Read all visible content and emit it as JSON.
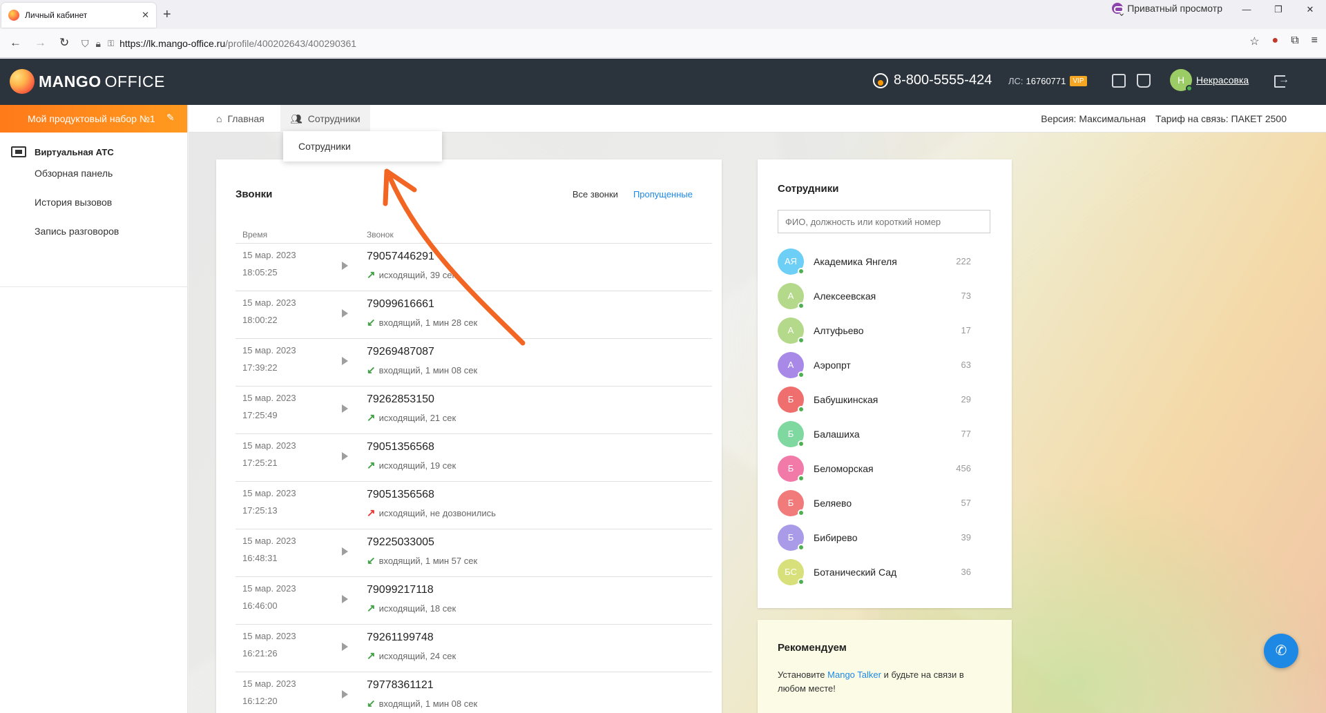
{
  "browser": {
    "tab_title": "Личный кабинет",
    "tab_close": "✕",
    "new_tab": "+",
    "private_label": "Приватный просмотр",
    "url_host": "https://lk.mango-office.ru",
    "url_path": "/profile/400202643/400290361"
  },
  "header": {
    "logo_mango": "MANGO",
    "logo_office": "OFFICE",
    "phone": "8-800-5555-424",
    "account_label": "ЛС:",
    "account_number": "16760771",
    "vip_badge": "VIP",
    "user_initial": "Н",
    "user_name": "Некрасовка"
  },
  "sidebar": {
    "product_set": "Мой продуктовый набор №1",
    "section_title": "Виртуальная АТС",
    "items": [
      {
        "label": "Обзорная панель"
      },
      {
        "label": "История вызовов"
      },
      {
        "label": "Запись разговоров"
      }
    ]
  },
  "subnav": {
    "home": "Главная",
    "employees": "Сотрудники",
    "version": "Версия: Максимальная",
    "tariff": "Тариф на связь: ПАКЕТ 2500",
    "dropdown_item": "Сотрудники"
  },
  "calls": {
    "title": "Звонки",
    "filter_all": "Все звонки",
    "filter_missed": "Пропущенные",
    "col_time": "Время",
    "col_call": "Звонок",
    "rows": [
      {
        "date": "15 мар. 2023",
        "time": "18:05:25",
        "number": "79057446291",
        "desc": "исходящий, 39 сек",
        "dir": "↗",
        "kind": "out",
        "play": true
      },
      {
        "date": "15 мар. 2023",
        "time": "18:00:22",
        "number": "79099616661",
        "desc": "входящий, 1 мин 28 сек",
        "dir": "↙",
        "kind": "in",
        "play": true
      },
      {
        "date": "15 мар. 2023",
        "time": "17:39:22",
        "number": "79269487087",
        "desc": "входящий, 1 мин 08 сек",
        "dir": "↙",
        "kind": "in",
        "play": true
      },
      {
        "date": "15 мар. 2023",
        "time": "17:25:49",
        "number": "79262853150",
        "desc": "исходящий, 21 сек",
        "dir": "↗",
        "kind": "out",
        "play": true
      },
      {
        "date": "15 мар. 2023",
        "time": "17:25:21",
        "number": "79051356568",
        "desc": "исходящий, 19 сек",
        "dir": "↗",
        "kind": "out",
        "play": true
      },
      {
        "date": "15 мар. 2023",
        "time": "17:25:13",
        "number": "79051356568",
        "desc": "исходящий, не дозвонились",
        "dir": "↗",
        "kind": "fail",
        "play": false
      },
      {
        "date": "15 мар. 2023",
        "time": "16:48:31",
        "number": "79225033005",
        "desc": "входящий, 1 мин 57 сек",
        "dir": "↙",
        "kind": "in",
        "play": true
      },
      {
        "date": "15 мар. 2023",
        "time": "16:46:00",
        "number": "79099217118",
        "desc": "исходящий, 18 сек",
        "dir": "↗",
        "kind": "out",
        "play": true
      },
      {
        "date": "15 мар. 2023",
        "time": "16:21:26",
        "number": "79261199748",
        "desc": "исходящий, 24 сек",
        "dir": "↗",
        "kind": "out",
        "play": true
      },
      {
        "date": "15 мар. 2023",
        "time": "16:12:20",
        "number": "79778361121",
        "desc": "входящий, 1 мин 08 сек",
        "dir": "↙",
        "kind": "in",
        "play": true
      }
    ]
  },
  "employees": {
    "title": "Сотрудники",
    "search_placeholder": "ФИО, должность или короткий номер",
    "list": [
      {
        "initials": "АЯ",
        "name": "Академика Янгеля",
        "ext": "222",
        "color": "#6ecff6"
      },
      {
        "initials": "А",
        "name": "Алексеевская",
        "ext": "73",
        "color": "#b5d98a"
      },
      {
        "initials": "А",
        "name": "Алтуфьево",
        "ext": "17",
        "color": "#b5d98a"
      },
      {
        "initials": "А",
        "name": "Аэропрт",
        "ext": "63",
        "color": "#a989e8"
      },
      {
        "initials": "Б",
        "name": "Бабушкинская",
        "ext": "29",
        "color": "#ef6f6f"
      },
      {
        "initials": "Б",
        "name": "Балашиха",
        "ext": "77",
        "color": "#7fd8a0"
      },
      {
        "initials": "Б",
        "name": "Беломорская",
        "ext": "456",
        "color": "#f17aa8"
      },
      {
        "initials": "Б",
        "name": "Беляево",
        "ext": "57",
        "color": "#f17a7a"
      },
      {
        "initials": "Б",
        "name": "Бибирево",
        "ext": "39",
        "color": "#a99be8"
      },
      {
        "initials": "БС",
        "name": "Ботанический Сад",
        "ext": "36",
        "color": "#d7e07a"
      }
    ]
  },
  "recommend": {
    "title": "Рекомендуем",
    "text_before": "Установите ",
    "link": "Mango Talker",
    "text_after": " и будьте на связи в любом месте!"
  },
  "colors": {
    "accent": "#ff8a1e",
    "header_bg": "#2b343c",
    "link": "#1e88e5",
    "annotation_arrow": "#f26522"
  }
}
